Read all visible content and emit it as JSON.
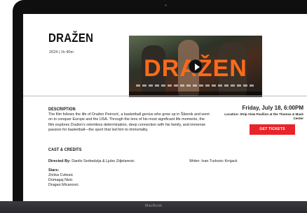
{
  "device": {
    "brand": "MacBook"
  },
  "film": {
    "title": "DRAŽEN",
    "meta": "2024 | 1h 40m",
    "trailer_overlay_title": "DRAŽEN"
  },
  "description": {
    "heading": "DESCRIPTION",
    "text": "The film follows the life of Dražen Petrović, a basketball genius who grew up in Šibenik and went on to conquer Europe and the USA. Through the lens of his most significant life moments, the film explores Dražen's relentless determination, deep connection with his family, and immense passion for basketball—the sport that led him to immortality."
  },
  "cast": {
    "heading": "CAST & CREDITS",
    "directed_label": "Directed By:",
    "directed_value": "Danilo Serbedzija & Ljubo Zdjelarevic",
    "writer": "Writer: Ivan Turkovic Krnjack",
    "stars_label": "Stars:",
    "stars": [
      "Zrinka Cvitesic",
      "Domagaj Nizic",
      "Dragan Micanovic"
    ]
  },
  "event": {
    "date": "Friday, July 18, 6:00PM",
    "location": "Location: Strip View Pavilion at the Thomas & Mack Center",
    "tickets_label": "GET TICKETS"
  },
  "colors": {
    "accent": "#e8242a",
    "overlay_title": "#ff6a1a"
  },
  "icons": {
    "play": "play-icon"
  }
}
